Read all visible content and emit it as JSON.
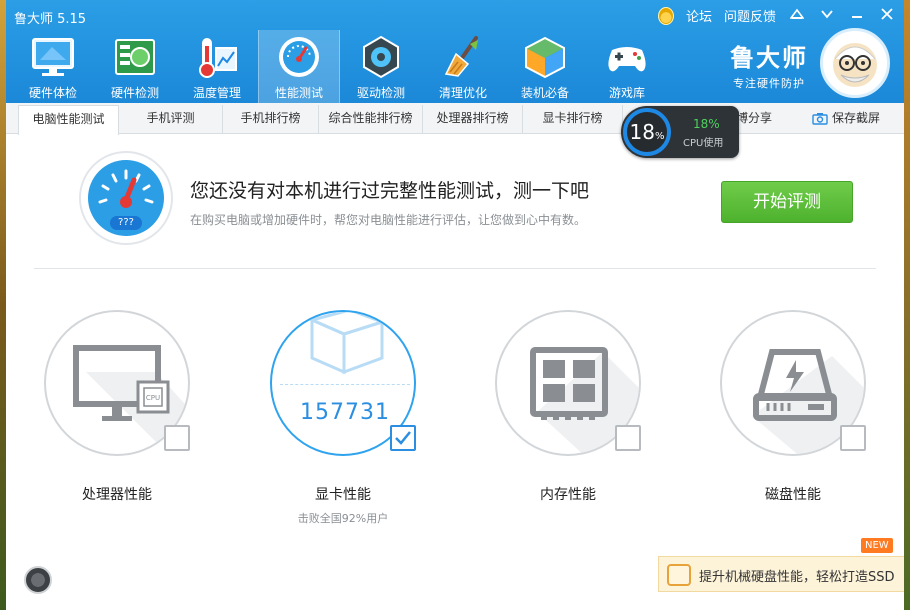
{
  "window": {
    "title": "鲁大师 5.15",
    "links": [
      "论坛",
      "问题反馈"
    ]
  },
  "nav": [
    {
      "label": "硬件体检",
      "icon": "monitor-check-icon"
    },
    {
      "label": "硬件检测",
      "icon": "circuit-board-icon"
    },
    {
      "label": "温度管理",
      "icon": "thermometer-icon"
    },
    {
      "label": "性能测试",
      "icon": "speedometer-icon",
      "active": true
    },
    {
      "label": "驱动检测",
      "icon": "gear-chip-icon"
    },
    {
      "label": "清理优化",
      "icon": "broom-icon"
    },
    {
      "label": "装机必备",
      "icon": "cube-box-icon"
    },
    {
      "label": "游戏库",
      "icon": "gamepad-icon"
    }
  ],
  "brand": {
    "name": "鲁大师",
    "slogan": "专注硬件防护"
  },
  "tabs": [
    "电脑性能测试",
    "手机评测",
    "手机排行榜",
    "综合性能排行榜",
    "处理器排行榜",
    "显卡排行榜"
  ],
  "share": {
    "weibo": "微博分享",
    "screenshot": "保存截屏"
  },
  "cpu": {
    "ring_value": "18",
    "ring_unit": "%",
    "usage_value": "18%",
    "usage_label": "CPU使用"
  },
  "hero": {
    "gauge_text": "???",
    "title": "您还没有对本机进行过完整性能测试，测一下吧",
    "subtitle": "在购买电脑或增加硬件时，帮您对电脑性能进行评估，让您做到心中有数。",
    "start_button": "开始评测"
  },
  "cards": [
    {
      "label": "处理器性能",
      "icon": "monitor-cpu-icon",
      "checked": false,
      "score": "",
      "sub": ""
    },
    {
      "label": "显卡性能",
      "icon": "wireframe-cube-icon",
      "checked": true,
      "score": "157731",
      "sub": "击败全国92%用户"
    },
    {
      "label": "内存性能",
      "icon": "ram-chip-icon",
      "checked": false,
      "score": "",
      "sub": ""
    },
    {
      "label": "磁盘性能",
      "icon": "hard-drive-icon",
      "checked": false,
      "score": "",
      "sub": ""
    }
  ],
  "promo": {
    "text": "提升机械硬盘性能，轻松打造SSD",
    "badge": "NEW"
  },
  "colors": {
    "topbar": "#1b88d8",
    "accent_blue": "#2b8ee0",
    "start_green": "#4eb22e",
    "badge_orange": "#ff7a21"
  }
}
